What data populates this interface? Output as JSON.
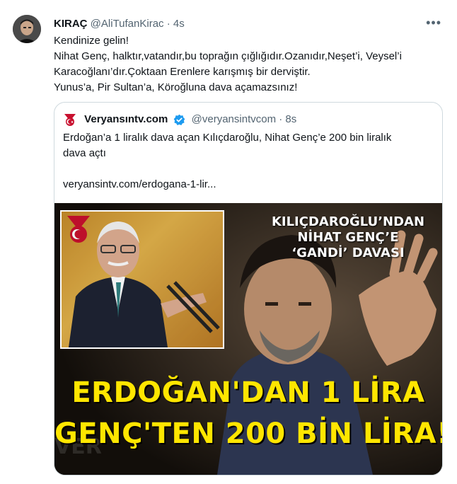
{
  "tweet": {
    "author_name": "KIRAÇ",
    "author_handle": "@AliTufanKirac",
    "separator": "·",
    "time": "4s",
    "more_icon": "•••",
    "text_lines": [
      "Kendinize gelin!",
      "Nihat Genç, halktır,vatandır,bu toprağın çığlığıdır.Ozanıdır,Neşet’i, Veysel’i",
      "Karacoğlanı’dır.Çoktaan Erenlere  karışmış bir derviştir.",
      "Yunus’a, Pir Sultan’a, Köroğluna dava açamazsınız!"
    ]
  },
  "quote": {
    "author_name": "Veryansıntv.com",
    "author_handle": "@veryansintvcom",
    "separator": "·",
    "time": "8s",
    "text_lines": [
      "Erdoğan’a 1 liralık dava açan Kılıçdaroğlu, Nihat Genç’e 200 bin liralık",
      "dava açtı"
    ],
    "link": "veryansintv.com/erdogana-1-lir...",
    "image": {
      "subheadline_lines": [
        "KILIÇDAROĞLU’NDAN",
        "NİHAT GENÇ’E",
        "‘GANDİ’ DAVASI"
      ],
      "headline_lines": [
        "ERDOĞAN'DAN 1 LİRA",
        "GENÇ'TEN 200 BİN LİRA!"
      ]
    }
  },
  "colors": {
    "text": "#0f1419",
    "secondary": "#536471",
    "border": "#cfd9de",
    "verified": "#1d9bf0",
    "headline": "#ffe600"
  },
  "icons": [
    "avatar",
    "more-icon",
    "veryansin-logo-icon",
    "verified-badge-icon"
  ]
}
